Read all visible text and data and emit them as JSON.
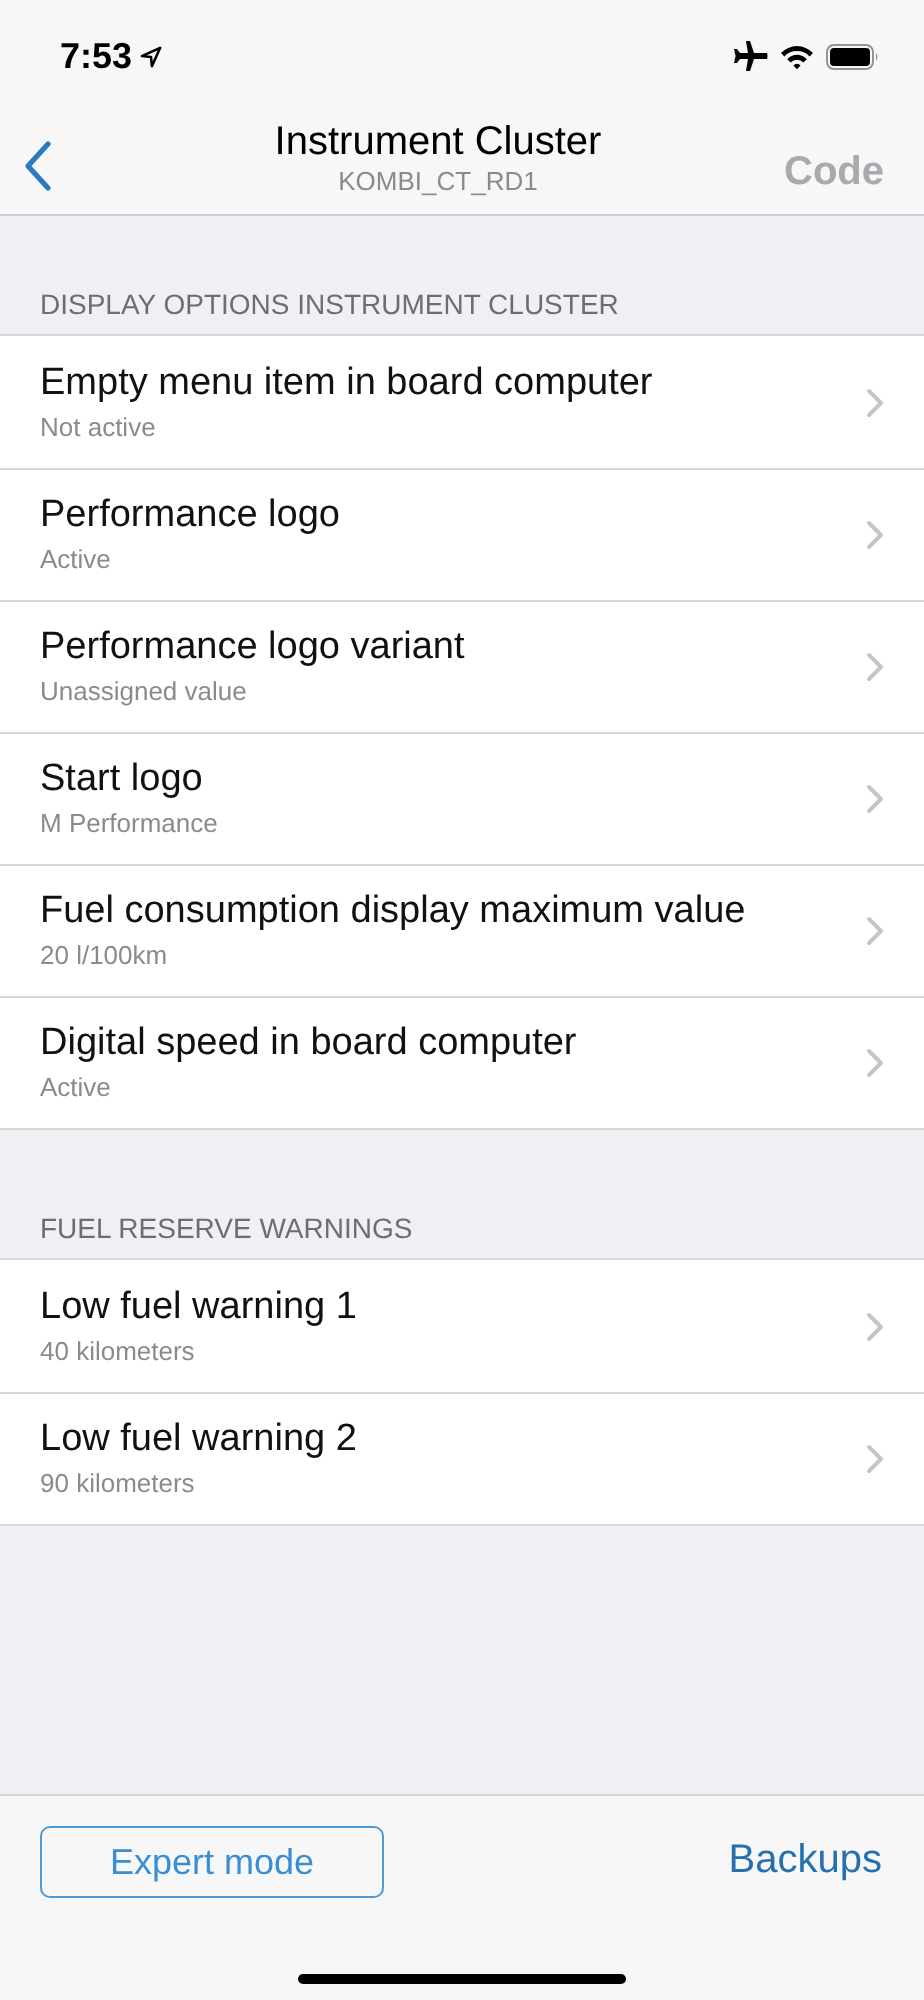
{
  "status_bar": {
    "time": "7:53"
  },
  "nav_bar": {
    "title": "Instrument Cluster",
    "subtitle": "KOMBI_CT_RD1",
    "action": {
      "label": "Code",
      "disabled": true
    }
  },
  "sections": [
    {
      "header": "DISPLAY OPTIONS INSTRUMENT CLUSTER",
      "items": [
        {
          "title": "Empty menu item in board computer",
          "value": "Not active"
        },
        {
          "title": "Performance logo",
          "value": "Active"
        },
        {
          "title": "Performance logo variant",
          "value": "Unassigned value"
        },
        {
          "title": "Start logo",
          "value": "M Performance"
        },
        {
          "title": "Fuel consumption display maximum value",
          "value": "20 l/100km"
        },
        {
          "title": "Digital speed in board computer",
          "value": "Active"
        }
      ]
    },
    {
      "header": "FUEL RESERVE WARNINGS",
      "items": [
        {
          "title": "Low fuel warning 1",
          "value": "40 kilometers"
        },
        {
          "title": "Low fuel warning 2",
          "value": "90 kilometers"
        }
      ]
    }
  ],
  "toolbar": {
    "left_button": "Expert mode",
    "right_button": "Backups"
  }
}
